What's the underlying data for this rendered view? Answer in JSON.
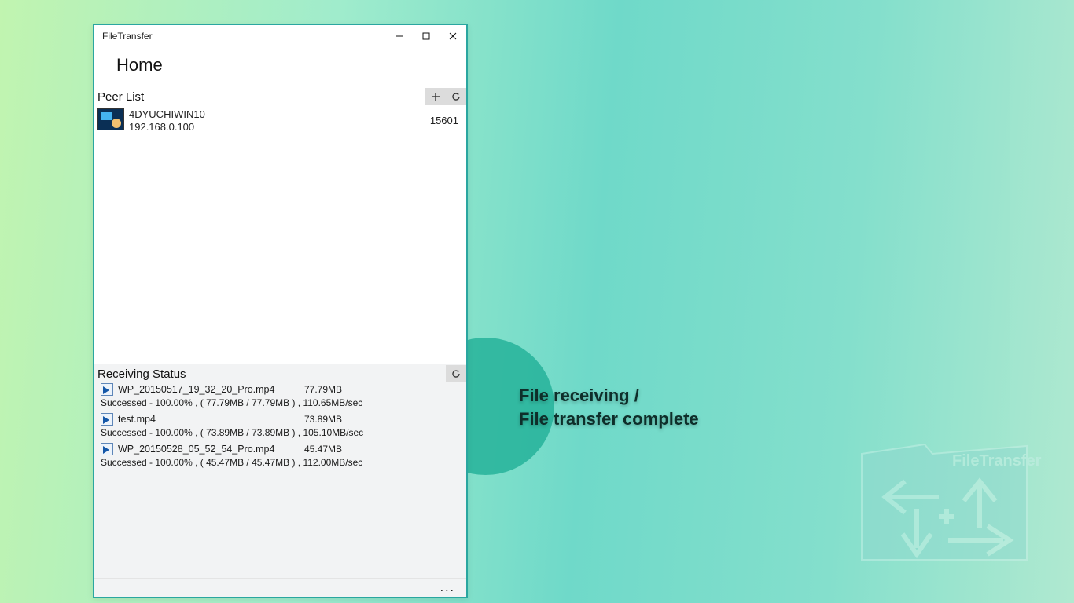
{
  "window": {
    "title": "FileTransfer",
    "nav_title": "Home"
  },
  "peerlist": {
    "header": "Peer List",
    "items": [
      {
        "name": "4DYUCHIWIN10",
        "ip": "192.168.0.100",
        "port": "15601"
      }
    ]
  },
  "receiving": {
    "header": "Receiving Status",
    "files": [
      {
        "name": "WP_20150517_19_32_20_Pro.mp4",
        "size": "77.79MB",
        "status": "Successed - 100.00% , ( 77.79MB / 77.79MB ) , 110.65MB/sec"
      },
      {
        "name": "test.mp4",
        "size": "73.89MB",
        "status": "Successed - 100.00% , ( 73.89MB / 73.89MB ) , 105.10MB/sec"
      },
      {
        "name": "WP_20150528_05_52_54_Pro.mp4",
        "size": "45.47MB",
        "status": "Successed - 100.00% , ( 45.47MB / 45.47MB ) , 112.00MB/sec"
      }
    ]
  },
  "overlay": {
    "line1": "File receiving /",
    "line2": "File transfer complete"
  },
  "logo": {
    "label": "FileTransfer"
  },
  "bottom": {
    "more": "..."
  }
}
